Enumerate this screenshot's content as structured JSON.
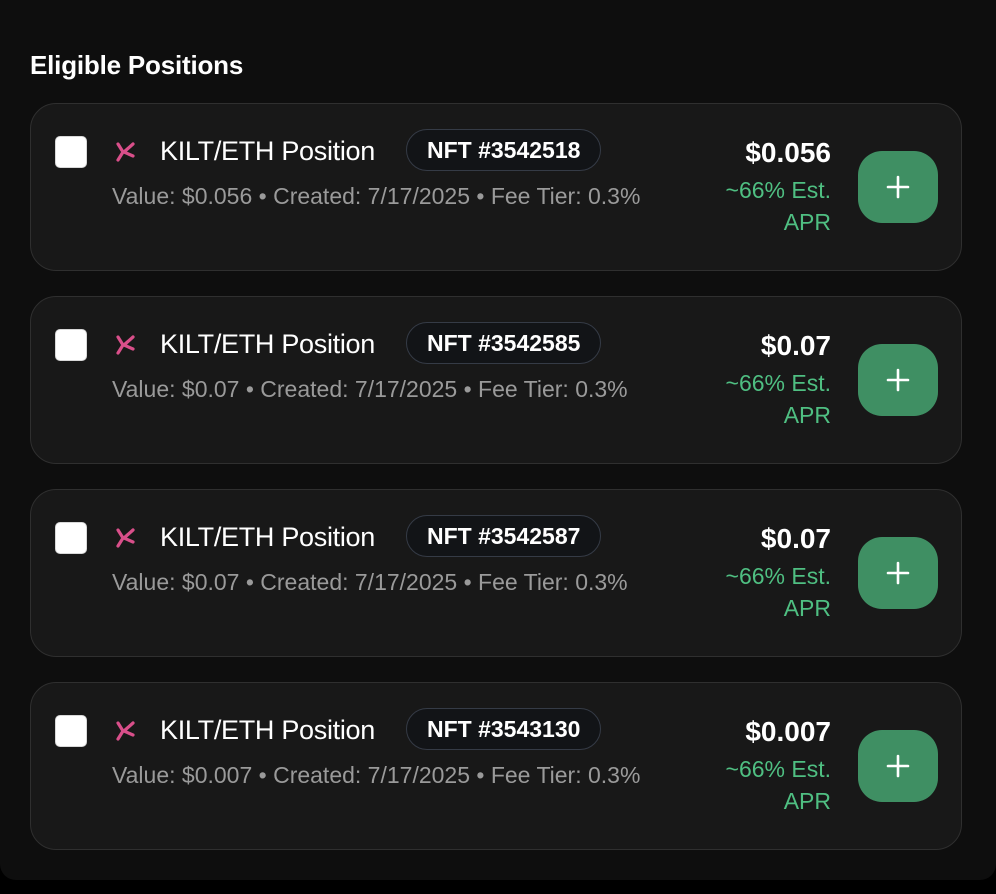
{
  "section": {
    "title": "Eligible Positions"
  },
  "positions": [
    {
      "title": "KILT/ETH Position",
      "nft": "NFT #3542518",
      "meta": "Value: $0.056 • Created: 7/17/2025 • Fee Tier: 0.3%",
      "value": "$0.056",
      "apr": "~66% Est. APR",
      "checked": false
    },
    {
      "title": "KILT/ETH Position",
      "nft": "NFT #3542585",
      "meta": "Value: $0.07 • Created: 7/17/2025 • Fee Tier: 0.3%",
      "value": "$0.07",
      "apr": "~66% Est. APR",
      "checked": false
    },
    {
      "title": "KILT/ETH Position",
      "nft": "NFT #3542587",
      "meta": "Value: $0.07 • Created: 7/17/2025 • Fee Tier: 0.3%",
      "value": "$0.07",
      "apr": "~66% Est. APR",
      "checked": false
    },
    {
      "title": "KILT/ETH Position",
      "nft": "NFT #3543130",
      "meta": "Value: $0.007 • Created: 7/17/2025 • Fee Tier: 0.3%",
      "value": "$0.007",
      "apr": "~66% Est. APR",
      "checked": false
    }
  ],
  "icons": {
    "token": "kilt-logo-icon",
    "add": "plus-icon"
  },
  "colors": {
    "accent_green": "#3f8f63",
    "apr_green": "#4fbf82",
    "kilt_pink": "#d94f8a"
  }
}
